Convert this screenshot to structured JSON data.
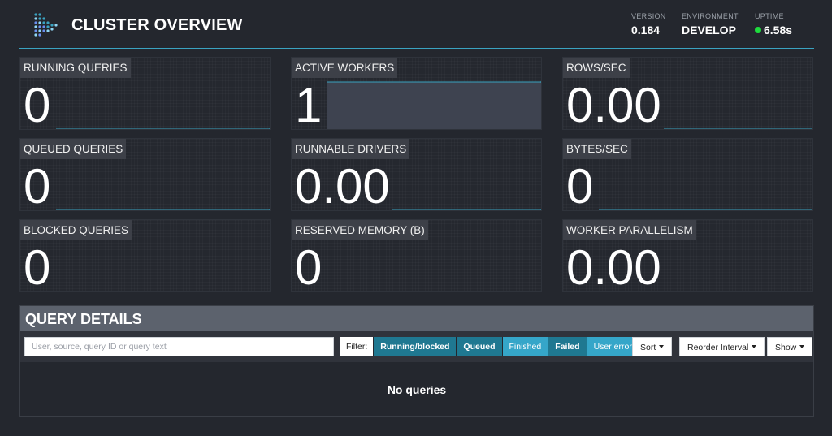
{
  "header": {
    "title": "CLUSTER OVERVIEW",
    "logo_icon": "presto-logo-icon",
    "stats": {
      "version": {
        "label": "VERSION",
        "value": "0.184"
      },
      "environment": {
        "label": "ENVIRONMENT",
        "value": "DEVELOP"
      },
      "uptime": {
        "label": "UPTIME",
        "value": "6.58s",
        "status_color": "#1edc3d"
      }
    }
  },
  "metrics": [
    {
      "title": "RUNNING QUERIES",
      "value": "0"
    },
    {
      "title": "ACTIVE WORKERS",
      "value": "1"
    },
    {
      "title": "ROWS/SEC",
      "value": "0.00"
    },
    {
      "title": "QUEUED QUERIES",
      "value": "0"
    },
    {
      "title": "RUNNABLE DRIVERS",
      "value": "0.00"
    },
    {
      "title": "BYTES/SEC",
      "value": "0"
    },
    {
      "title": "BLOCKED QUERIES",
      "value": "0"
    },
    {
      "title": "RESERVED MEMORY (B)",
      "value": "0"
    },
    {
      "title": "WORKER PARALLELISM",
      "value": "0.00"
    }
  ],
  "query_details": {
    "title": "QUERY DETAILS",
    "search_placeholder": "User, source, query ID or query text",
    "filter_label": "Filter:",
    "filters": [
      {
        "label": "Running/blocked",
        "active": true
      },
      {
        "label": "Queued",
        "active": true
      },
      {
        "label": "Finished",
        "active": false
      },
      {
        "label": "Failed",
        "active": true
      },
      {
        "label": "User error",
        "active": false
      }
    ],
    "sort_label": "Sort",
    "reorder_label": "Reorder Interval",
    "show_label": "Show",
    "empty_message": "No queries"
  },
  "colors": {
    "accent": "#3aa3c1",
    "filter_active": "#1f7891",
    "filter_inactive": "#35a6c9",
    "background": "#24272e"
  }
}
